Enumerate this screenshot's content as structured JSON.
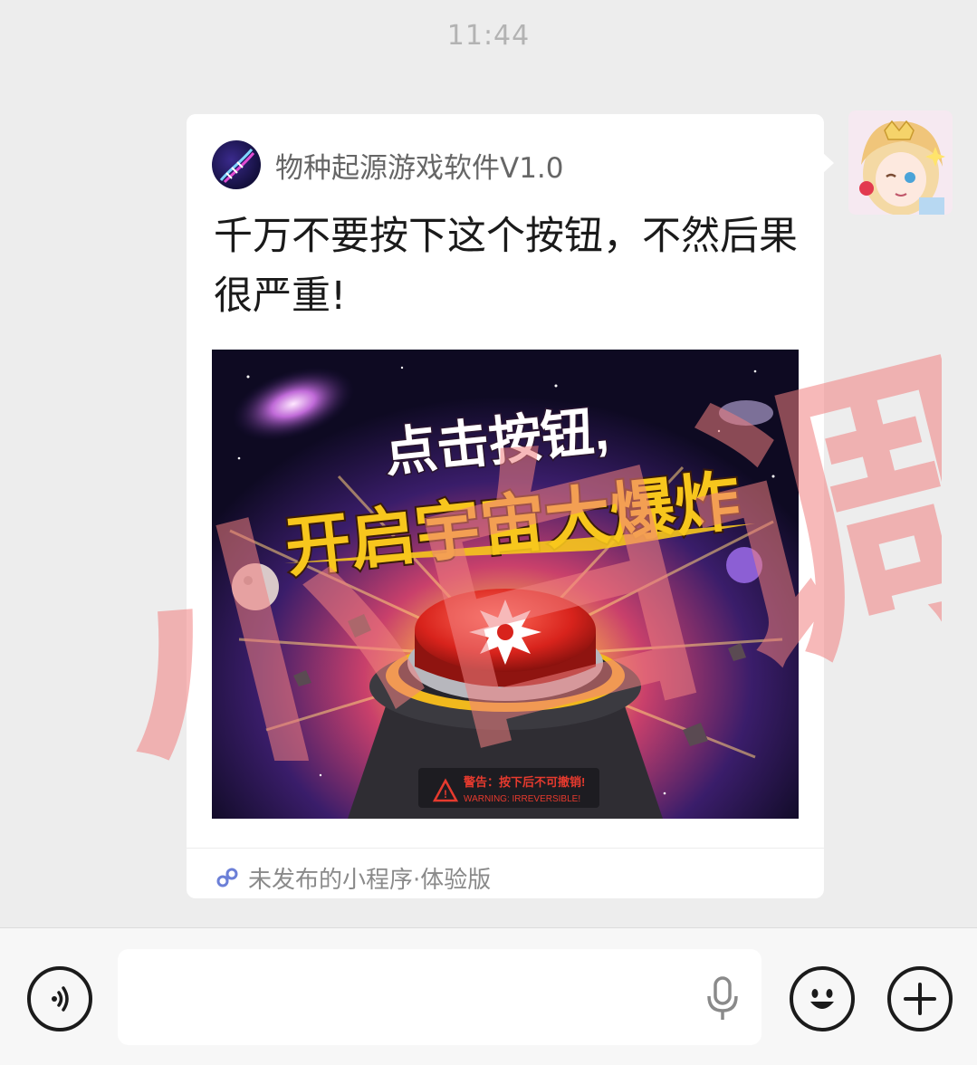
{
  "chat": {
    "timestamp": "11:44"
  },
  "miniprogram_card": {
    "app_name": "物种起源游戏软件V1.0",
    "title": "千万不要按下这个按钮，不然后果很严重!",
    "cover": {
      "headline_line1": "点击按钮,",
      "headline_line2": "开启宇宙大爆炸",
      "warning_cn": "警告：按下后不可撤销!",
      "warning_en": "WARNING: IRREVERSIBLE!"
    },
    "footer_label": "未发布的小程序·体验版"
  },
  "watermark": {
    "text": "小白调"
  },
  "icons": {
    "voice": "voice-mode-icon",
    "mic": "microphone-icon",
    "emoji": "emoji-icon",
    "plus": "plus-icon",
    "link": "miniprogram-link-icon"
  },
  "colors": {
    "chat_bg": "#ededed",
    "card_bg": "#ffffff",
    "watermark": "#f08080",
    "headline_yellow": "#f7c61d",
    "button_red": "#d8231c"
  }
}
